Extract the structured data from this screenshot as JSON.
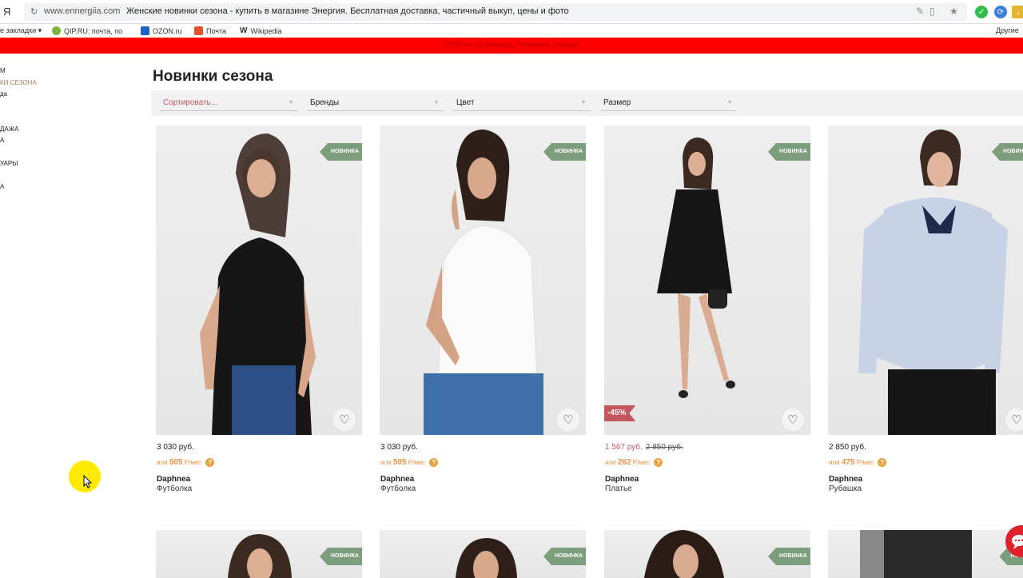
{
  "browser": {
    "logo": "Я",
    "domain": "www.ennergiia.com",
    "title": "Женские новинки сезона - купить в магазине Энергия. Бесплатная доставка, частичный выкуп, цены и фото",
    "bookmarks": [
      {
        "label": "е закладки ▾"
      },
      {
        "label": "QIP.RU: почта, по"
      },
      {
        "label": "OZON.ru"
      },
      {
        "label": "Почта"
      },
      {
        "label": "Wikipedia"
      }
    ],
    "other_bookmarks": "Другие"
  },
  "promo": {
    "text": "-35% по промокоду \"Новинки сезона\""
  },
  "sidebar": {
    "items": [
      {
        "label": "М"
      },
      {
        "label": "КИ СЕЗОНА"
      },
      {
        "label": "да"
      },
      {
        "label": "ДАЖА"
      },
      {
        "label": "А"
      },
      {
        "label": "УАРЫ"
      },
      {
        "label": "А"
      }
    ]
  },
  "page": {
    "title": "Новинки сезона"
  },
  "filters": [
    {
      "label": "Сортировать..."
    },
    {
      "label": "Бренды"
    },
    {
      "label": "Цвет"
    },
    {
      "label": "Размер"
    }
  ],
  "filter_plus": "+",
  "colors": {
    "promo": "#ff0000",
    "new_badge": "#7d9e7d",
    "sale_badge": "#c5565e",
    "installment": "#e8903e"
  },
  "products": [
    {
      "badge": "НОВИНКА",
      "price": "3 030 руб.",
      "installment_prefix": "или",
      "installment": "505",
      "installment_unit": "Р/мес",
      "brand": "Daphnea",
      "type": "Футболка"
    },
    {
      "badge": "НОВИНКА",
      "price": "3 030 руб.",
      "installment_prefix": "или",
      "installment": "505",
      "installment_unit": "Р/мес",
      "brand": "Daphnea",
      "type": "Футболка"
    },
    {
      "badge": "НОВИНКА",
      "sale": "-45%",
      "price": "1 567 руб.",
      "old_price": "2 850 руб.",
      "installment_prefix": "или",
      "installment": "262",
      "installment_unit": "Р/мес",
      "brand": "Daphnea",
      "type": "Платье"
    },
    {
      "badge": "НОВИНКА",
      "price": "2 850 руб.",
      "installment_prefix": "или",
      "installment": "475",
      "installment_unit": "Р/мес",
      "brand": "Daphnea",
      "type": "Рубашка"
    }
  ],
  "row2_badges": [
    "НОВИНКА",
    "НОВИНКА",
    "НОВИНКА",
    "НОВИН"
  ],
  "help_glyph": "?"
}
